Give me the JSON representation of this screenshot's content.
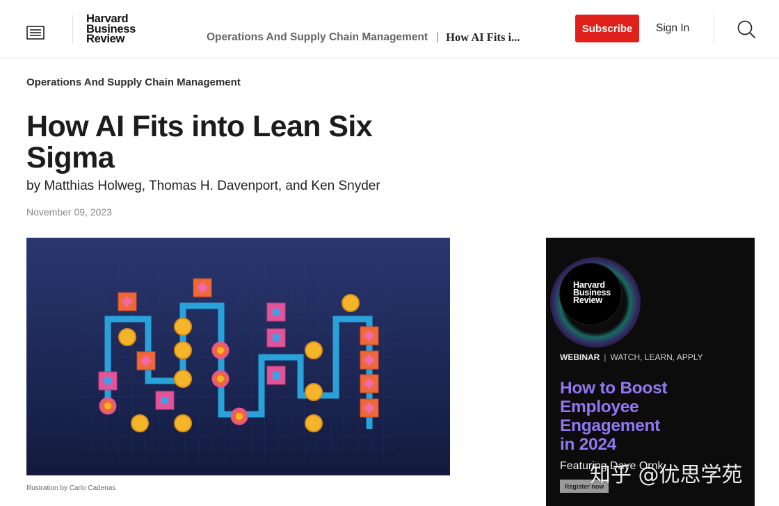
{
  "header": {
    "logo_line1": "Harvard",
    "logo_line2": "Business",
    "logo_line3": "Review",
    "breadcrumb_topic": "Operations And Supply Chain Management",
    "breadcrumb_separator": "|",
    "breadcrumb_current": "How AI Fits i...",
    "subscribe_label": "Subscribe",
    "signin_label": "Sign In",
    "icons": {
      "menu": "menu-icon",
      "search": "search-icon"
    }
  },
  "article": {
    "topic": "Operations And Supply Chain Management",
    "title": "How AI Fits into Lean Six Sigma",
    "byline": "by Matthias Holweg, Thomas H. Davenport, and Ken Snyder",
    "date": "November 09, 2023",
    "image_caption": "Illustration by Carlo Cadenas"
  },
  "ad": {
    "logo_line1": "Harvard",
    "logo_line2": "Business",
    "logo_line3": "Review",
    "kicker_bold": "WEBINAR",
    "kicker_separator": "|",
    "kicker_rest": "WATCH, LEARN, APPLY",
    "headline_line1": "How to Boost",
    "headline_line2": "Employee",
    "headline_line3": "Engagement",
    "headline_line4": "in 2024",
    "featuring": "Featuring Dave Ornk",
    "register_label": "Register now"
  },
  "watermark": "知乎 @优思学苑",
  "colors": {
    "subscribe_bg": "#e0201b",
    "ad_headline": "#8f78f2",
    "hero_bg": "#1e2a5c",
    "flow_line": "#2aa9e0",
    "pink_square": "#e0559a",
    "orange_square": "#f0683a",
    "yellow_circle": "#f5b52a"
  }
}
